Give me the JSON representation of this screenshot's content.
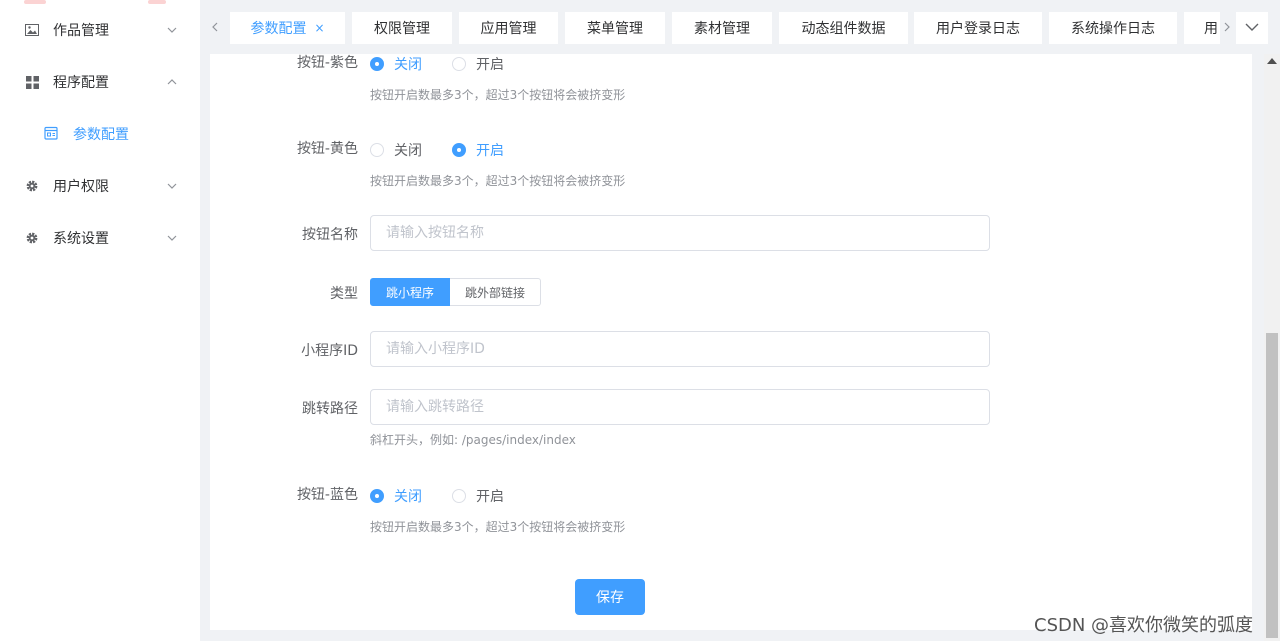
{
  "sidebar": {
    "items": [
      {
        "label": "作品管理",
        "icon": "image-icon",
        "expanded": false
      },
      {
        "label": "程序配置",
        "icon": "grid-icon",
        "expanded": true
      },
      {
        "label": "用户权限",
        "icon": "gear-icon",
        "expanded": false
      },
      {
        "label": "系统设置",
        "icon": "gear-icon",
        "expanded": false
      }
    ],
    "subitem": {
      "label": "参数配置",
      "icon": "calendar-icon"
    }
  },
  "tabs": [
    {
      "label": "参数配置",
      "active": true,
      "closable": true
    },
    {
      "label": "权限管理"
    },
    {
      "label": "应用管理"
    },
    {
      "label": "菜单管理"
    },
    {
      "label": "素材管理"
    },
    {
      "label": "动态组件数据"
    },
    {
      "label": "用户登录日志"
    },
    {
      "label": "系统操作日志"
    },
    {
      "label": "用"
    }
  ],
  "tab_close_glyph": "×",
  "form": {
    "purple": {
      "label": "按钮-紫色",
      "opt_off": "关闭",
      "opt_on": "开启",
      "value": "关闭",
      "hint": "按钮开启数最多3个，超过3个按钮将会被挤变形"
    },
    "yellow": {
      "label": "按钮-黄色",
      "opt_off": "关闭",
      "opt_on": "开启",
      "value": "开启",
      "hint": "按钮开启数最多3个，超过3个按钮将会被挤变形"
    },
    "name": {
      "label": "按钮名称",
      "placeholder": "请输入按钮名称",
      "value": ""
    },
    "type": {
      "label": "类型",
      "options": [
        "跳小程序",
        "跳外部链接"
      ],
      "value": "跳小程序"
    },
    "appid": {
      "label": "小程序ID",
      "placeholder": "请输入小程序ID",
      "value": ""
    },
    "path": {
      "label": "跳转路径",
      "placeholder": "请输入跳转路径",
      "value": "",
      "hint": "斜杠开头，例如: /pages/index/index"
    },
    "blue": {
      "label": "按钮-蓝色",
      "opt_off": "关闭",
      "opt_on": "开启",
      "value": "关闭",
      "hint": "按钮开启数最多3个，超过3个按钮将会被挤变形"
    },
    "save_label": "保存"
  },
  "watermark": "CSDN @喜欢你微笑的弧度",
  "colors": {
    "accent": "#409eff",
    "text": "#606266",
    "hint": "#909399",
    "border": "#dcdfe6"
  }
}
